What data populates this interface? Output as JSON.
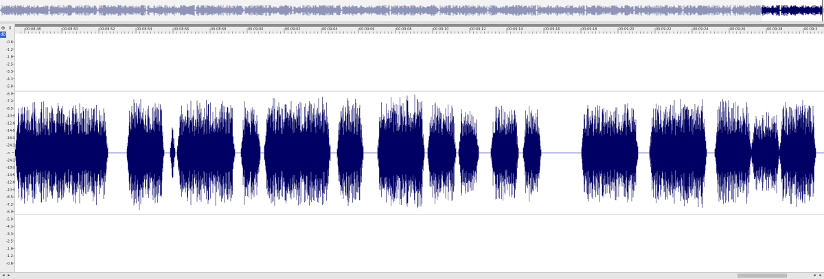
{
  "overview": {
    "label": "Track overview",
    "wave_color": "#8f94b8",
    "selected_color": "#000064",
    "selected_range": [
      0.925,
      0.998
    ]
  },
  "left_strip": {
    "nav_icon": "hand-icon",
    "nav_glyph": "⊕",
    "zoom_icon": "vertical-zoom-icon",
    "zoom_glyph": "⇳",
    "db_tag": "dB"
  },
  "ruler": {
    "labels": [
      "00:08:48",
      "00:08:50",
      "00:08:52",
      "00:08:54",
      "00:08:56",
      "00:08:58",
      "00:09:00",
      "00:09:02",
      "00:09:04",
      "00:09:06",
      "00:09:08",
      "00:09:10",
      "00:09:12",
      "00:09:14",
      "00:09:16",
      "00:09:18",
      "00:09:20",
      "00:09:22",
      "00:09:24",
      "00:09:26",
      "00:09:28",
      "00:09:3"
    ]
  },
  "db_scale": {
    "labels": [
      "-0.6",
      "-1.2",
      "-1.8",
      "-2.5",
      "-3.3",
      "-4.1",
      "-5.0",
      "-6.0",
      "-7.2",
      "-8.5",
      "-10.1",
      "-12.0",
      "-14.5",
      "-18.1",
      "-24.1",
      "-∞",
      "-24.1",
      "-18.1",
      "-14.5",
      "-12.0",
      "-10.1",
      "-8.5",
      "-7.2",
      "-6.0",
      "-5.0",
      "-4.1",
      "-3.3",
      "-2.5",
      "-1.8",
      "-1.2",
      "-0.6"
    ]
  },
  "waveform": {
    "color": "#000064",
    "centerline_color": "#4a55c8",
    "guide_color": "#9a9a9a",
    "bursts": [
      [
        0.0,
        0.115,
        0.85
      ],
      [
        0.138,
        0.184,
        0.95
      ],
      [
        0.192,
        0.198,
        0.7
      ],
      [
        0.2,
        0.272,
        0.9
      ],
      [
        0.279,
        0.303,
        0.85
      ],
      [
        0.308,
        0.39,
        0.95
      ],
      [
        0.398,
        0.43,
        0.9
      ],
      [
        0.448,
        0.506,
        1.0
      ],
      [
        0.51,
        0.545,
        0.9
      ],
      [
        0.548,
        0.573,
        0.8
      ],
      [
        0.588,
        0.622,
        0.85
      ],
      [
        0.623,
        0.62,
        0.9
      ],
      [
        0.628,
        0.65,
        0.9
      ],
      [
        0.7,
        0.77,
        0.85
      ],
      [
        0.784,
        0.855,
        0.9
      ],
      [
        0.865,
        0.91,
        0.9
      ],
      [
        0.91,
        0.945,
        0.7
      ],
      [
        0.945,
        0.99,
        0.9
      ]
    ]
  },
  "scrollbar": {
    "left_glyph": "◂",
    "left2_glyph": "▸",
    "right_glyph": "◂",
    "right2_glyph": "▸",
    "thumb_range": [
      0.895,
      0.955
    ]
  }
}
